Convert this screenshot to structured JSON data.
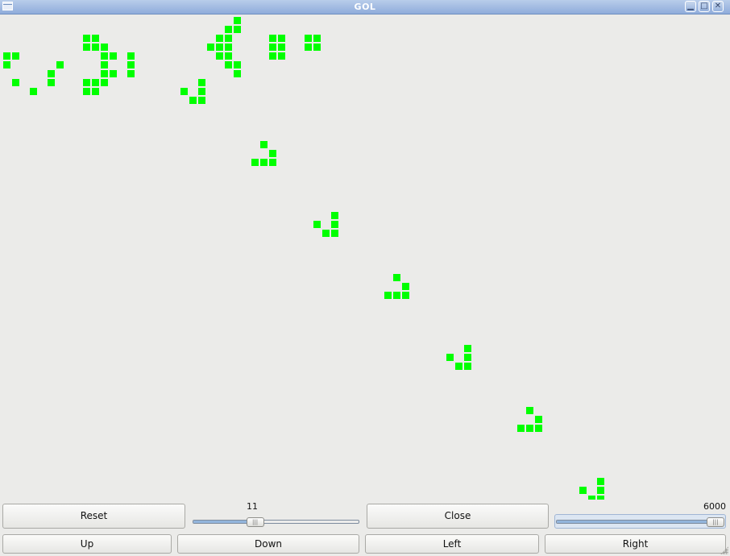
{
  "window": {
    "title": "GOL",
    "min_glyph": "▁",
    "max_glyph": "□",
    "close_glyph": "✕"
  },
  "board": {
    "cell_color": "#00ff00",
    "background": "#ebebe9",
    "live_cells": [
      [
        26,
        0
      ],
      [
        25,
        1
      ],
      [
        26,
        1
      ],
      [
        9,
        2
      ],
      [
        10,
        2
      ],
      [
        24,
        2
      ],
      [
        25,
        2
      ],
      [
        30,
        2
      ],
      [
        31,
        2
      ],
      [
        34,
        2
      ],
      [
        35,
        2
      ],
      [
        9,
        3
      ],
      [
        10,
        3
      ],
      [
        11,
        3
      ],
      [
        23,
        3
      ],
      [
        24,
        3
      ],
      [
        25,
        3
      ],
      [
        30,
        3
      ],
      [
        31,
        3
      ],
      [
        34,
        3
      ],
      [
        35,
        3
      ],
      [
        0,
        4
      ],
      [
        1,
        4
      ],
      [
        11,
        4
      ],
      [
        12,
        4
      ],
      [
        14,
        4
      ],
      [
        24,
        4
      ],
      [
        25,
        4
      ],
      [
        30,
        4
      ],
      [
        31,
        4
      ],
      [
        0,
        5
      ],
      [
        6,
        5
      ],
      [
        11,
        5
      ],
      [
        14,
        5
      ],
      [
        25,
        5
      ],
      [
        26,
        5
      ],
      [
        5,
        6
      ],
      [
        11,
        6
      ],
      [
        12,
        6
      ],
      [
        14,
        6
      ],
      [
        26,
        6
      ],
      [
        1,
        7
      ],
      [
        5,
        7
      ],
      [
        9,
        7
      ],
      [
        10,
        7
      ],
      [
        11,
        7
      ],
      [
        22,
        7
      ],
      [
        3,
        8
      ],
      [
        9,
        8
      ],
      [
        10,
        8
      ],
      [
        20,
        8
      ],
      [
        22,
        8
      ],
      [
        21,
        9
      ],
      [
        22,
        9
      ],
      [
        29,
        14
      ],
      [
        30,
        15
      ],
      [
        28,
        16
      ],
      [
        29,
        16
      ],
      [
        30,
        16
      ],
      [
        37,
        22
      ],
      [
        35,
        23
      ],
      [
        37,
        23
      ],
      [
        36,
        24
      ],
      [
        37,
        24
      ],
      [
        44,
        29
      ],
      [
        45,
        30
      ],
      [
        43,
        31
      ],
      [
        44,
        31
      ],
      [
        45,
        31
      ],
      [
        52,
        37
      ],
      [
        50,
        38
      ],
      [
        52,
        38
      ],
      [
        51,
        39
      ],
      [
        52,
        39
      ],
      [
        59,
        44
      ],
      [
        60,
        45
      ],
      [
        58,
        46
      ],
      [
        59,
        46
      ],
      [
        60,
        46
      ],
      [
        67,
        52
      ],
      [
        65,
        53
      ],
      [
        67,
        53
      ],
      [
        66,
        54
      ],
      [
        67,
        54
      ]
    ]
  },
  "controls": {
    "reset_label": "Reset",
    "close_label": "Close",
    "up_label": "Up",
    "down_label": "Down",
    "left_label": "Left",
    "right_label": "Right",
    "speed_slider": {
      "value": "11",
      "fraction": 0.36
    },
    "generation_slider": {
      "value": "6000",
      "fraction": 1.0
    },
    "thumb_glyph": "|||"
  }
}
